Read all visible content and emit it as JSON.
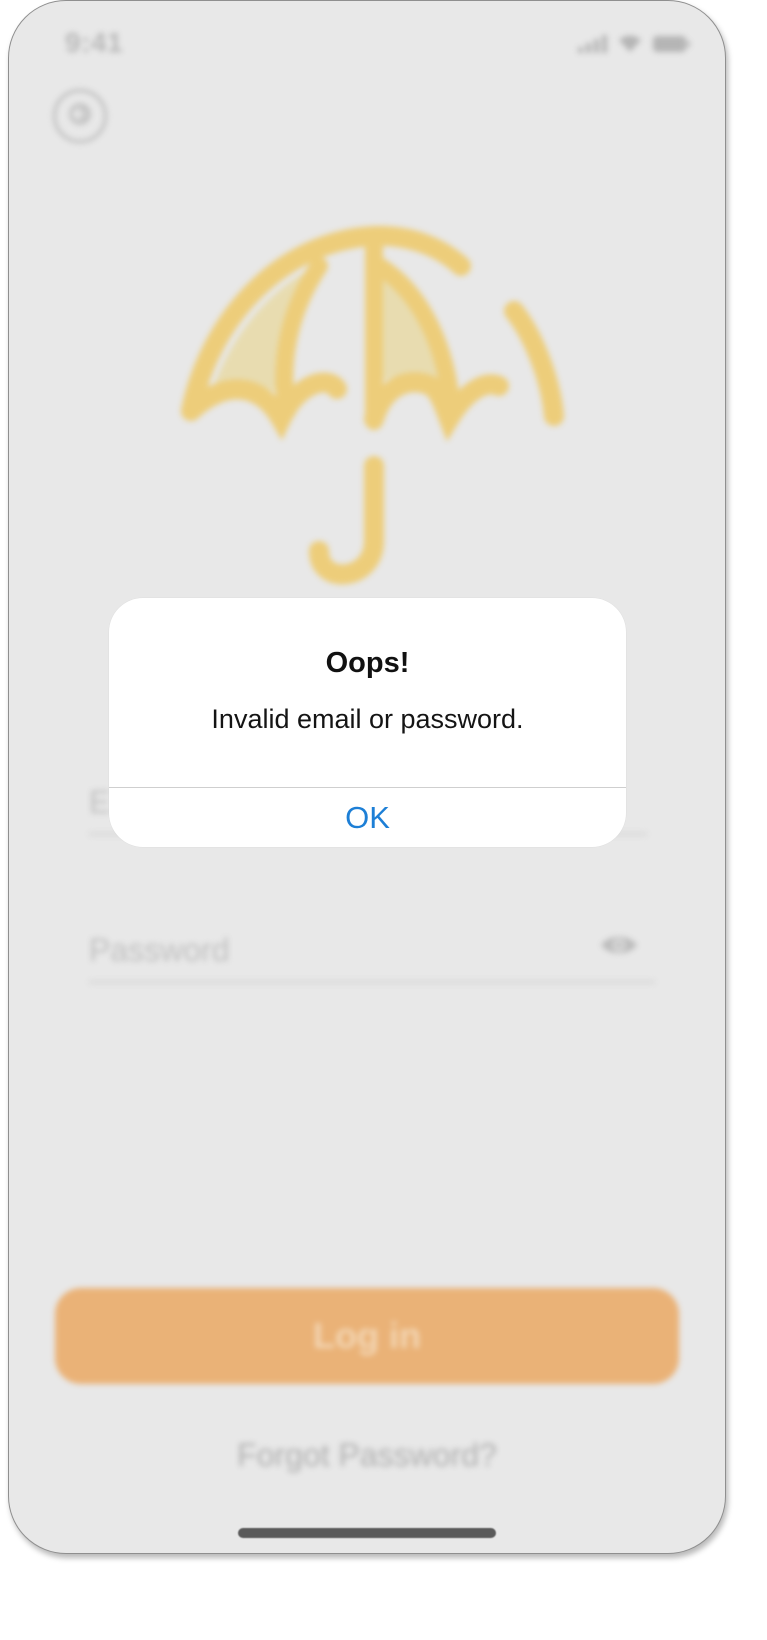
{
  "status_bar": {
    "time": "9:41",
    "icons": [
      "signal-icon",
      "wifi-icon",
      "battery-icon"
    ]
  },
  "header": {
    "back_icon": "arrow-left-icon"
  },
  "logo": {
    "icon": "umbrella-icon",
    "color": "#edcd7a",
    "fill_color": "#e8dcb0"
  },
  "welcome": {
    "title": ""
  },
  "form": {
    "email_placeholder": "E",
    "password_placeholder": "Password",
    "visibility_icon": "eye-icon"
  },
  "login_button": {
    "label": "Log in",
    "color": "#eab277"
  },
  "forgot_link": {
    "label": "Forgot Password?"
  },
  "alert": {
    "title": "Oops!",
    "message": "Invalid email or password.",
    "ok_label": "OK",
    "ok_color": "#1d7fd6"
  }
}
